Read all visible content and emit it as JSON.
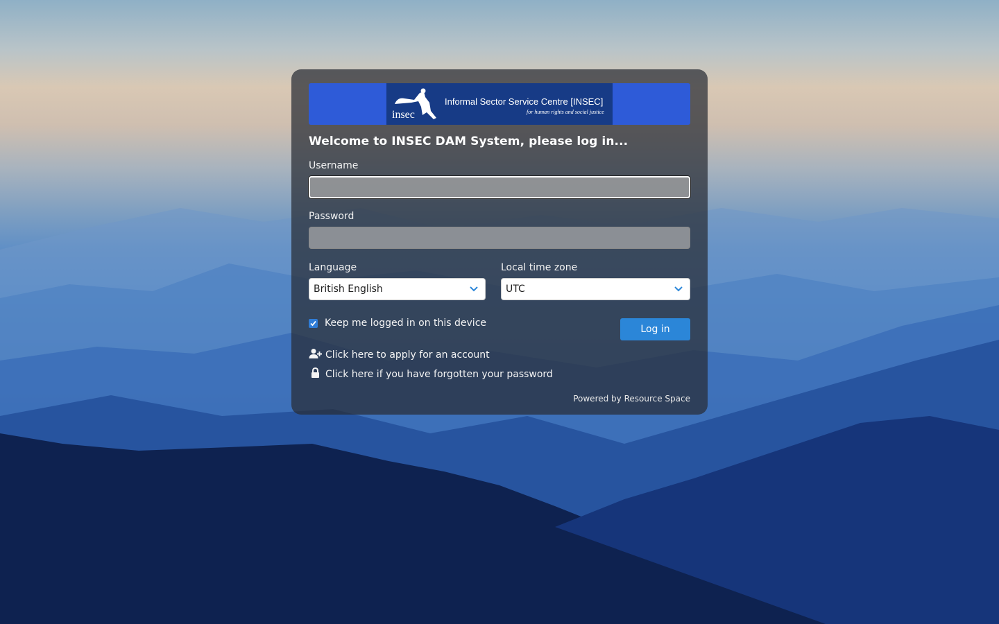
{
  "brand": {
    "logo_title": "Informal Sector Service Centre [INSEC]",
    "logo_tagline": "for human rights and social justice",
    "logo_mark_text": "insec"
  },
  "login": {
    "welcome": "Welcome to INSEC DAM System, please log in...",
    "username_label": "Username",
    "username_value": "",
    "password_label": "Password",
    "password_value": "",
    "language_label": "Language",
    "language_selected": "British English",
    "timezone_label": "Local time zone",
    "timezone_selected": "UTC",
    "keep_logged_in_label": "Keep me logged in on this device",
    "keep_logged_in_checked": true,
    "login_button": "Log in",
    "apply_account_link": "Click here to apply for an account",
    "forgot_password_link": "Click here if you have forgotten your password",
    "powered_by": "Powered by Resource Space"
  },
  "icons": {
    "apply": "user-plus-icon",
    "forgot": "lock-icon",
    "select_arrow": "chevron-down-icon",
    "checkbox": "checkmark-icon"
  },
  "colors": {
    "banner": "#2e5bd8",
    "logo_bg": "#173b86",
    "button": "#2b86d8",
    "checkbox": "#2f7cd6"
  }
}
